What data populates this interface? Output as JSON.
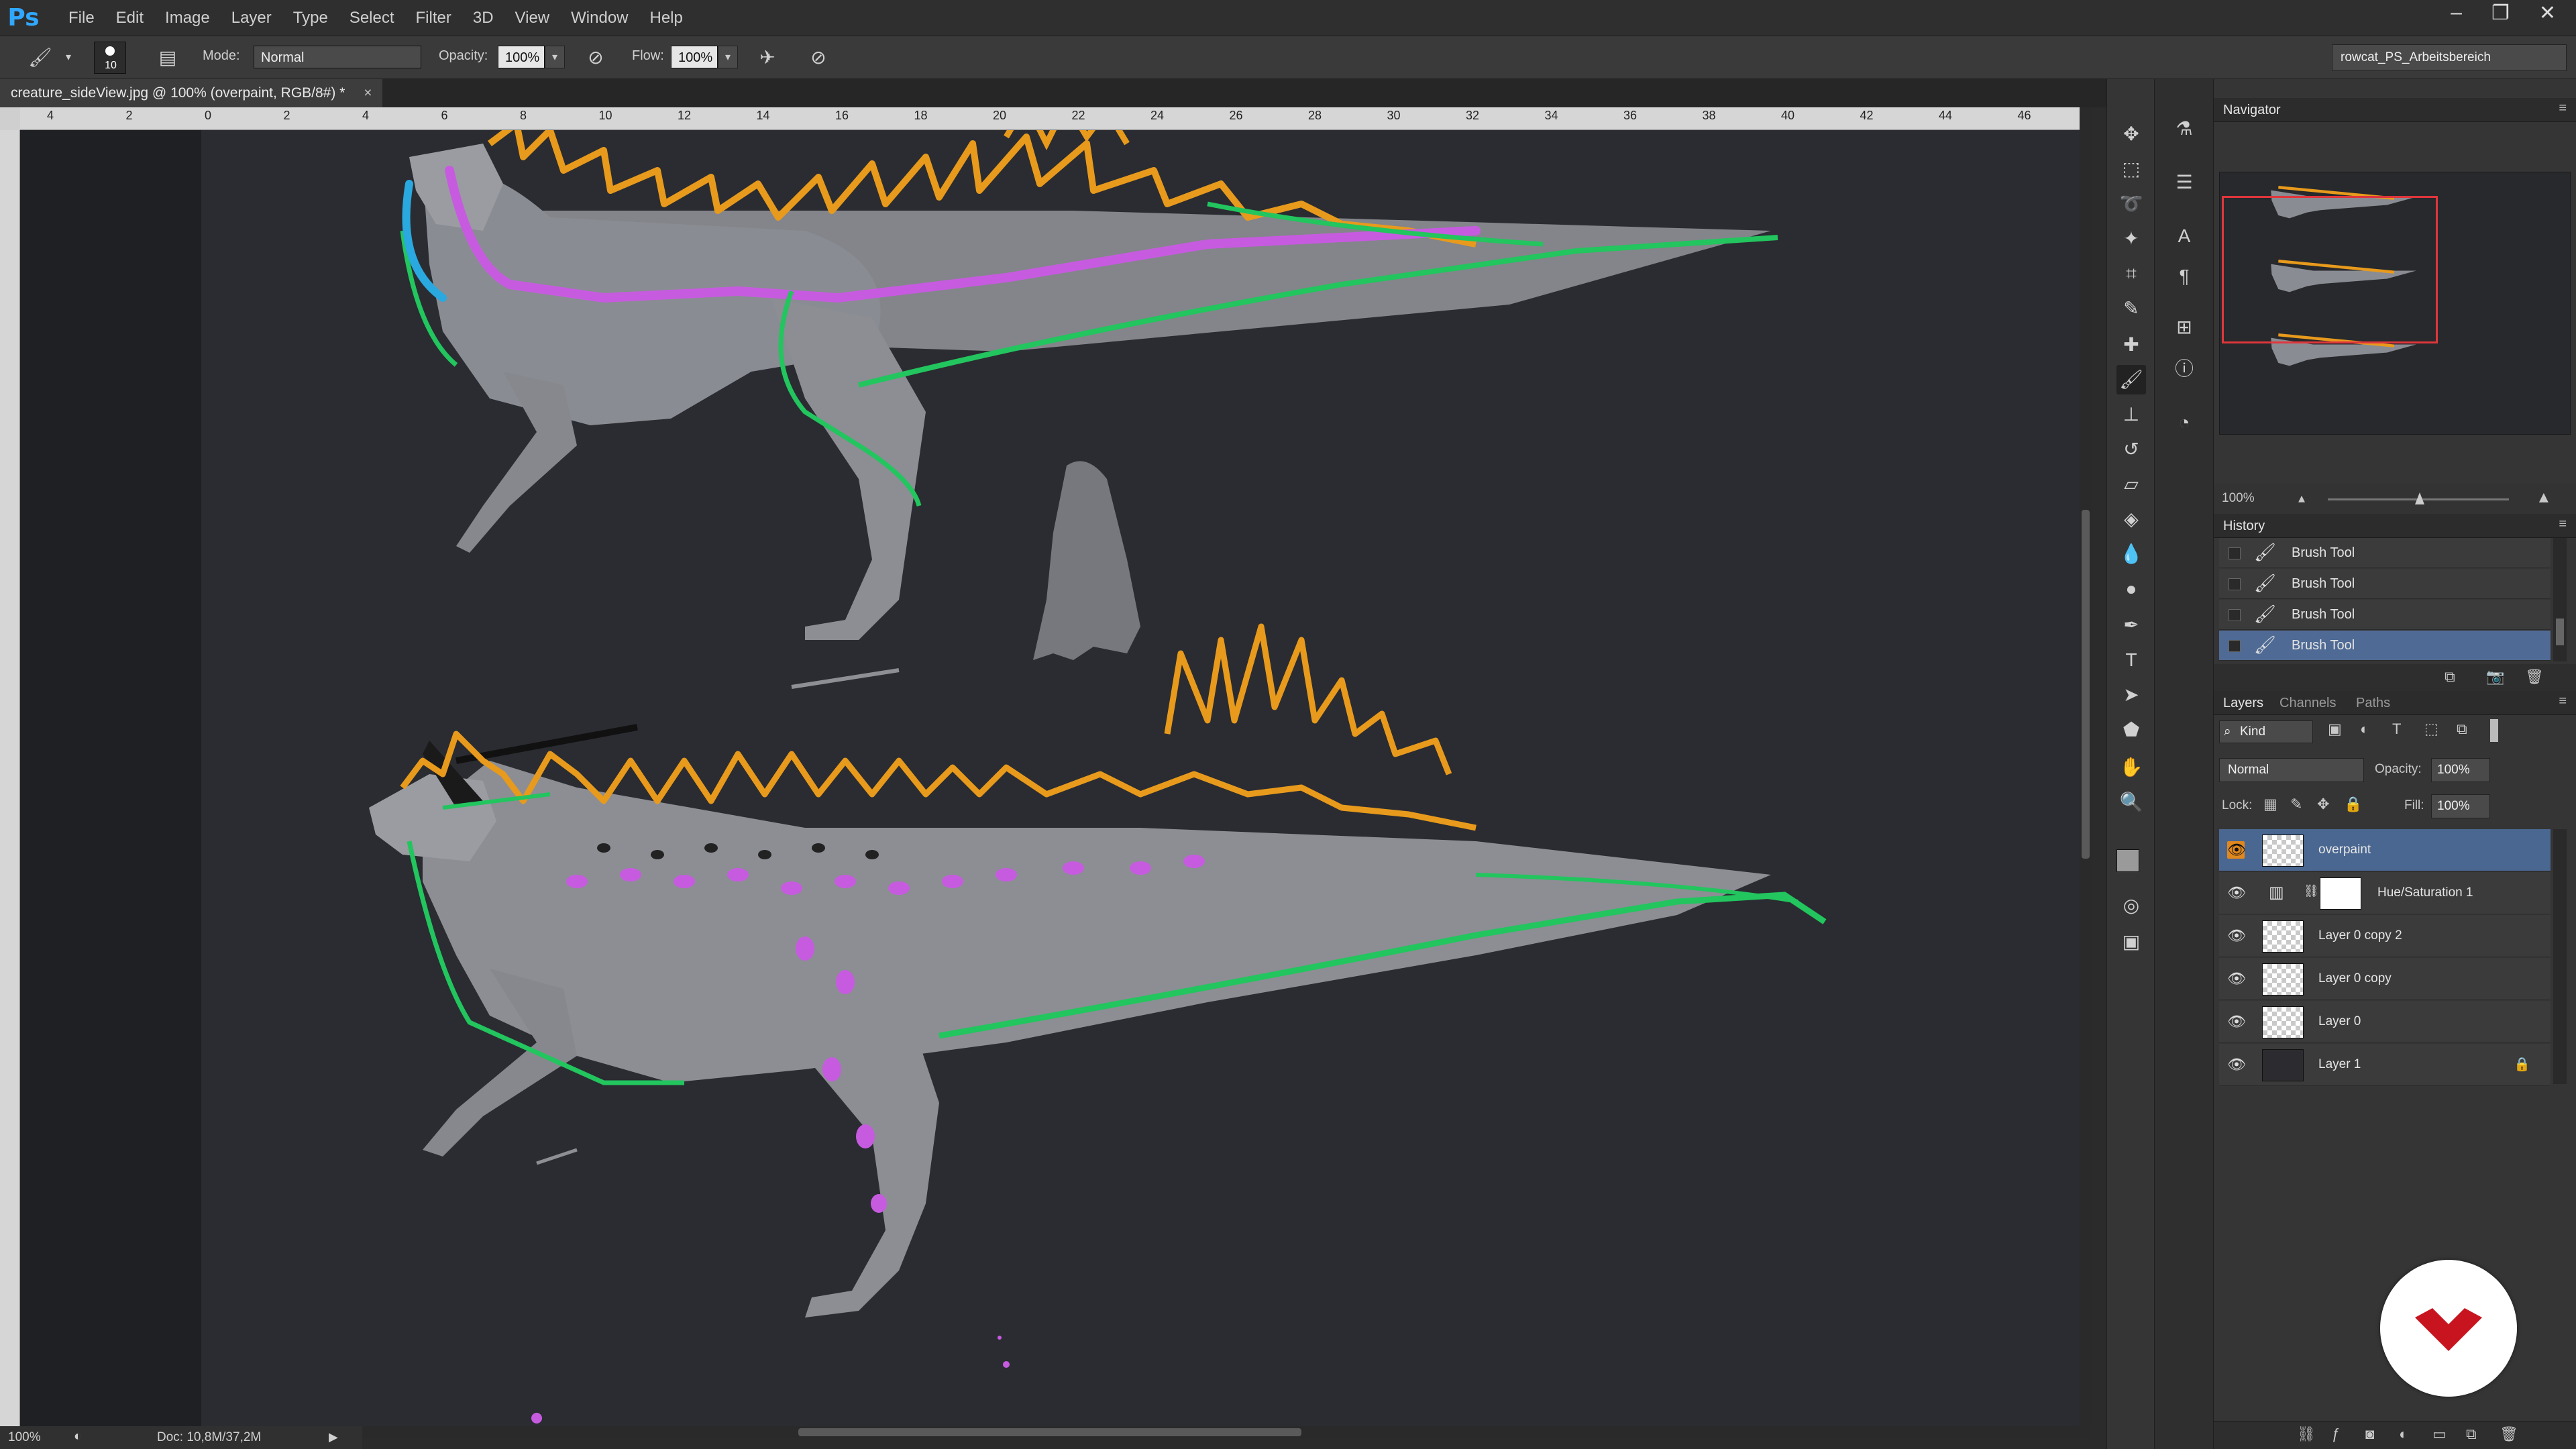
{
  "app": {
    "logo_text": "Ps"
  },
  "menu": [
    "File",
    "Edit",
    "Image",
    "Layer",
    "Type",
    "Select",
    "Filter",
    "3D",
    "View",
    "Window",
    "Help"
  ],
  "window_controls": [
    "–",
    "❐",
    "✕"
  ],
  "options": {
    "brush_size": "10",
    "mode_label": "Mode:",
    "mode_value": "Normal",
    "opacity_label": "Opacity:",
    "opacity_value": "100%",
    "flow_label": "Flow:",
    "flow_value": "100%"
  },
  "workspace": "rowcat_PS_Arbeitsbereich",
  "document": {
    "tab_title": "creature_sideView.jpg @ 100% (overpaint, RGB/8#) *",
    "close": "×"
  },
  "ruler_h": [
    "4",
    "2",
    "0",
    "2",
    "4",
    "6",
    "8",
    "10",
    "12",
    "14",
    "16",
    "18",
    "20",
    "22",
    "24",
    "26",
    "28",
    "30",
    "32",
    "34",
    "36",
    "38",
    "40",
    "42",
    "44",
    "46"
  ],
  "status": {
    "zoom": "100%",
    "doc": "Doc: 10,8M/37,2M"
  },
  "navigator": {
    "title": "Navigator",
    "zoom": "100%"
  },
  "history": {
    "title": "History",
    "items": [
      "Brush Tool",
      "Brush Tool",
      "Brush Tool",
      "Brush Tool"
    ],
    "selected_index": 3
  },
  "layers_panel": {
    "tabs": [
      "Layers",
      "Channels",
      "Paths"
    ],
    "filter_kind": "Kind",
    "blend_mode": "Normal",
    "opacity_label": "Opacity:",
    "opacity_value": "100%",
    "lock_label": "Lock:",
    "fill_label": "Fill:",
    "fill_value": "100%",
    "layers": [
      {
        "name": "overpaint",
        "selected": true
      },
      {
        "name": "Hue/Saturation 1",
        "adjustment": true
      },
      {
        "name": "Layer 0 copy 2"
      },
      {
        "name": "Layer 0 copy"
      },
      {
        "name": "Layer 0"
      },
      {
        "name": "Layer 1",
        "locked": true
      }
    ]
  },
  "colors": {
    "accent_orange": "#e0881e",
    "nav_rect": "#e0363c",
    "spike_orange": "#e89a1c",
    "line_green": "#22c55e",
    "stripe_violet": "#c75be0",
    "horn_blue": "#2aa8e0",
    "body_gray": "#8d8f95"
  }
}
